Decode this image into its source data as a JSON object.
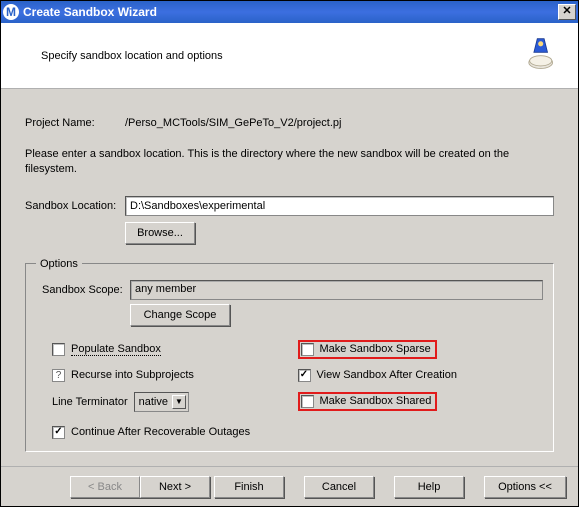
{
  "title": "Create Sandbox Wizard",
  "subtitle": "Specify sandbox location and options",
  "project": {
    "label": "Project Name:",
    "value": "/Perso_MCTools/SIM_GePeTo_V2/project.pj"
  },
  "description": "Please enter a sandbox location.  This is the directory where the new sandbox will be created on the filesystem.",
  "location": {
    "label": "Sandbox Location:",
    "value": "D:\\Sandboxes\\experimental",
    "browse": "Browse..."
  },
  "options": {
    "legend": "Options",
    "scope_label": "Sandbox Scope:",
    "scope_value": "any member",
    "change_scope": "Change Scope",
    "populate": "Populate Sandbox",
    "sparse": "Make Sandbox Sparse",
    "recurse": "Recurse into Subprojects",
    "view_after": "View Sandbox After Creation",
    "line_terminator_label": "Line Terminator",
    "line_terminator_value": "native",
    "shared": "Make Sandbox Shared",
    "continue": "Continue After Recoverable Outages"
  },
  "footer": {
    "back": "< Back",
    "next": "Next >",
    "finish": "Finish",
    "cancel": "Cancel",
    "help": "Help",
    "options": "Options <<"
  }
}
